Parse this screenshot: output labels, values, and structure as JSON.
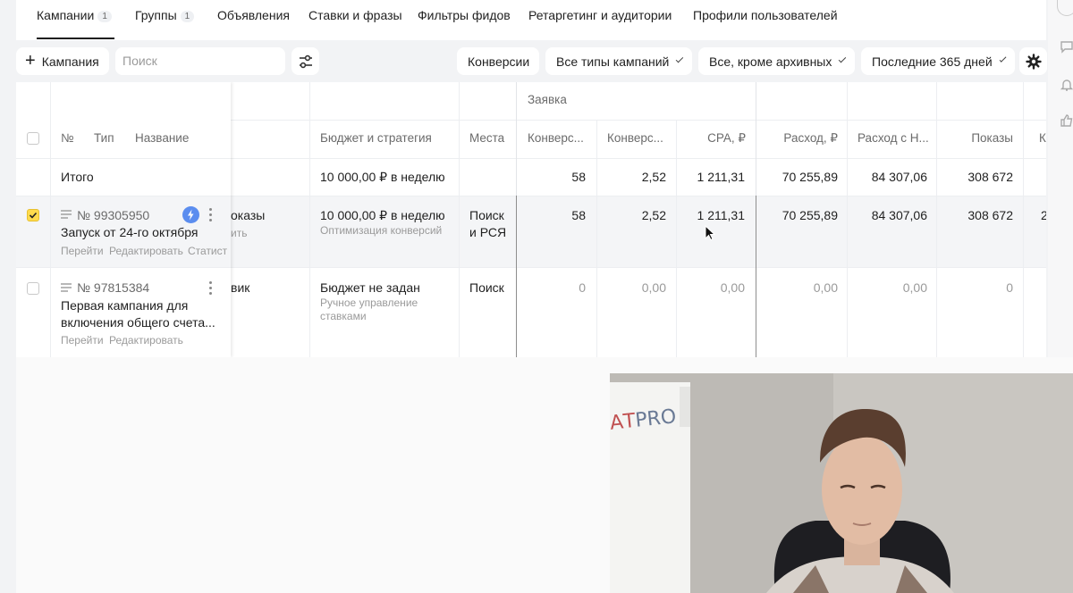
{
  "tabs": [
    {
      "label": "Кампании",
      "count": "1"
    },
    {
      "label": "Группы",
      "count": "1"
    },
    {
      "label": "Объявления",
      "count": ""
    },
    {
      "label": "Ставки и фразы",
      "count": ""
    },
    {
      "label": "Фильтры фидов",
      "count": ""
    },
    {
      "label": "Ретаргетинг и аудитории",
      "count": ""
    },
    {
      "label": "Профили пользователей",
      "count": ""
    }
  ],
  "toolbar": {
    "add_label": "Кампания",
    "search_placeholder": "Поиск",
    "conversions": "Конверсии",
    "campaign_types": "Все типы кампаний",
    "archive_filter": "Все, кроме архивных",
    "period": "Последние 365 дней"
  },
  "table": {
    "group_header": "Заявка",
    "headers": {
      "no": "№",
      "type": "Тип",
      "name": "Название",
      "budget": "Бюджет и стратегия",
      "places": "Места",
      "conv1": "Конверс...",
      "conv2": "Конверс...",
      "cpa": "CPA, ₽",
      "spend": "Расход, ₽",
      "spend_vat": "Расход с Н...",
      "impressions": "Показы",
      "more": "К"
    },
    "total": {
      "label": "Итого",
      "budget": "10 000,00 ₽ в неделю",
      "conv1": "58",
      "conv2": "2,52",
      "cpa": "1 211,31",
      "spend": "70 255,89",
      "spend_vat": "84 307,06",
      "impressions": "308 672"
    },
    "rows": [
      {
        "number": "№ 99305950",
        "name": "Запуск от 24-го октября",
        "actions": [
          "Перейти",
          "Редактировать",
          "Статист"
        ],
        "hidden_col": "оказы",
        "hidden_col_sub": "ить",
        "budget": "10 000,00 ₽ в неделю",
        "strategy": "Оптимизация конверсий",
        "places_1": "Поиск",
        "places_2": "и РСЯ",
        "conv1": "58",
        "conv2": "2,52",
        "cpa": "1 211,31",
        "spend": "70 255,89",
        "spend_vat": "84 307,06",
        "impressions": "308 672",
        "more": "2"
      },
      {
        "number": "№ 97815384",
        "name_1": "Первая кампания для",
        "name_2": "включения общего счета...",
        "actions": [
          "Перейти",
          "Редактировать"
        ],
        "hidden_col": "вик",
        "budget": "Бюджет не задан",
        "strategy_1": "Ручное управление",
        "strategy_2": "ставками",
        "places_1": "Поиск",
        "conv1": "0",
        "conv2": "0,00",
        "cpa": "0,00",
        "spend": "0,00",
        "spend_vat": "0,00",
        "impressions": "0"
      }
    ]
  },
  "webcam": {
    "board_text": "PRO",
    "board_prefix": "АТ"
  },
  "colors": {
    "accent_yellow": "#ffdb4d",
    "lightning_blue": "#5b8def"
  }
}
